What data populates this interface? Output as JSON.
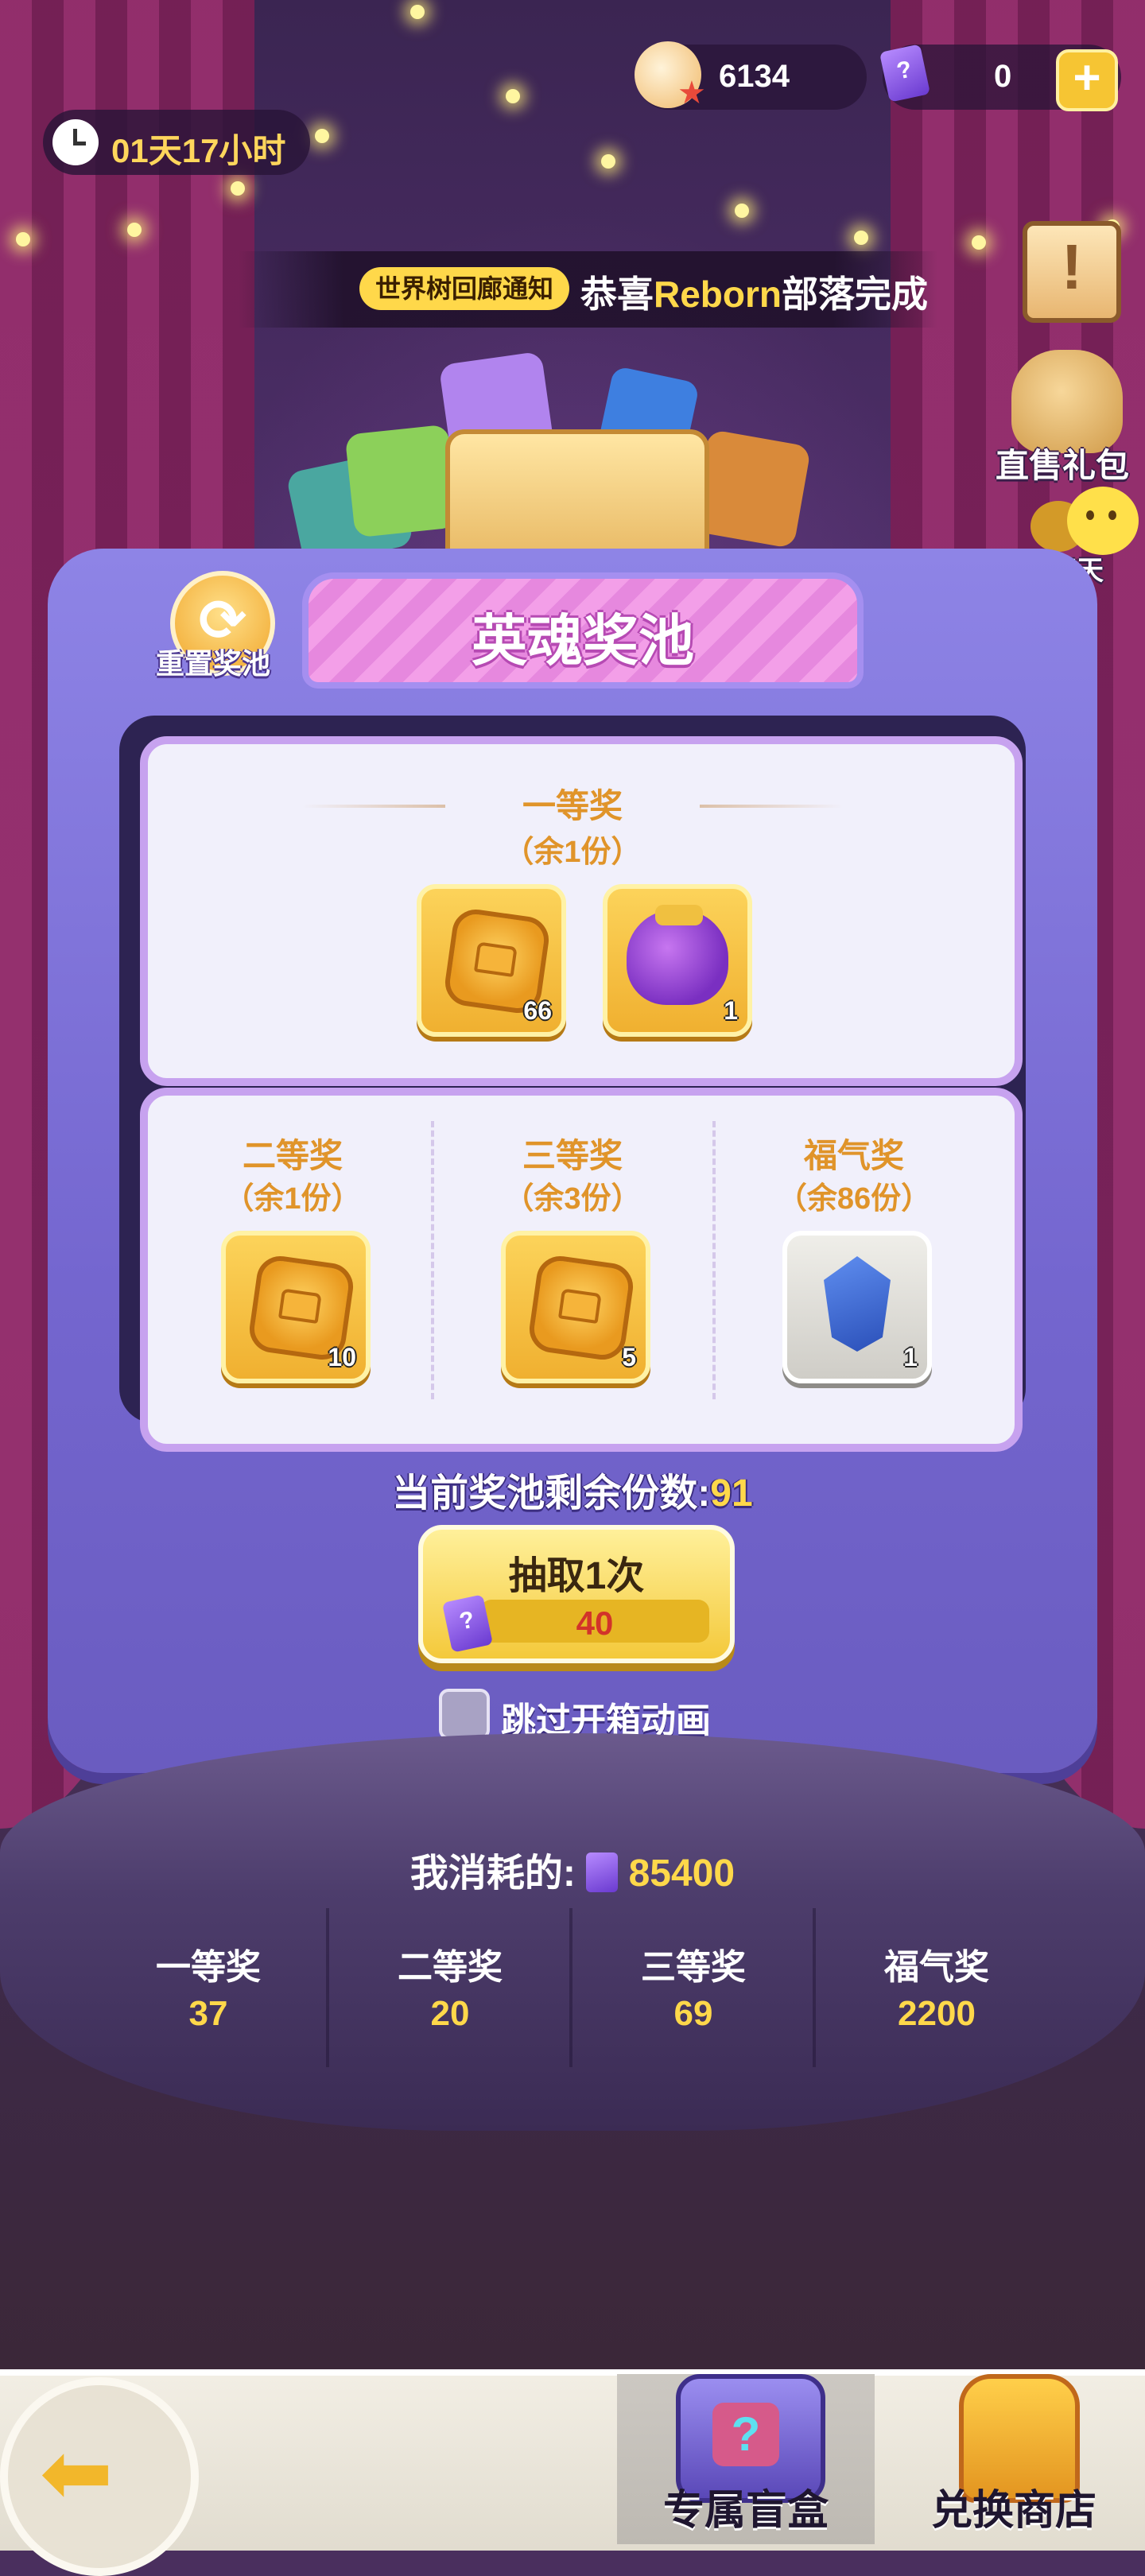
{
  "currency": {
    "shells": "6134",
    "tickets": "0"
  },
  "timer": "01天17小时",
  "notice": {
    "tag": "世界树回廊通知",
    "prefix": "恭喜",
    "highlight": "Reborn",
    "suffix": "部落完成"
  },
  "side_menu": {
    "gift": "直售礼包",
    "chat": "聊天"
  },
  "pool": {
    "title": "英魂奖池",
    "reset_label": "重置奖池",
    "first": {
      "name": "一等奖",
      "remain": "（余1份）",
      "items": [
        {
          "icon": "coin-icon",
          "qty": "66"
        },
        {
          "icon": "bag-icon",
          "qty": "1"
        }
      ]
    },
    "second": {
      "name": "二等奖",
      "remain": "（余1份）",
      "qty": "10"
    },
    "third": {
      "name": "三等奖",
      "remain": "（余3份）",
      "qty": "5"
    },
    "lucky": {
      "name": "福气奖",
      "remain": "（余86份）",
      "qty": "1"
    },
    "remaining_label": "当前奖池剩余份数:",
    "remaining_value": "91"
  },
  "draw": {
    "label": "抽取1次",
    "cost": "40"
  },
  "skip_label": "跳过开箱动画",
  "consumed": {
    "label": "我消耗的:",
    "value": "85400"
  },
  "stats": [
    {
      "label": "一等奖",
      "value": "37"
    },
    {
      "label": "二等奖",
      "value": "20"
    },
    {
      "label": "三等奖",
      "value": "69"
    },
    {
      "label": "福气奖",
      "value": "2200"
    }
  ],
  "tabs": {
    "blind_box": "专属盲盒",
    "exchange": "兑换商店"
  },
  "colors": {
    "accent_yellow": "#ffd84a",
    "panel_purple": "#7466cf",
    "prize_orange": "#e0942a",
    "cost_red": "#d2332a"
  }
}
